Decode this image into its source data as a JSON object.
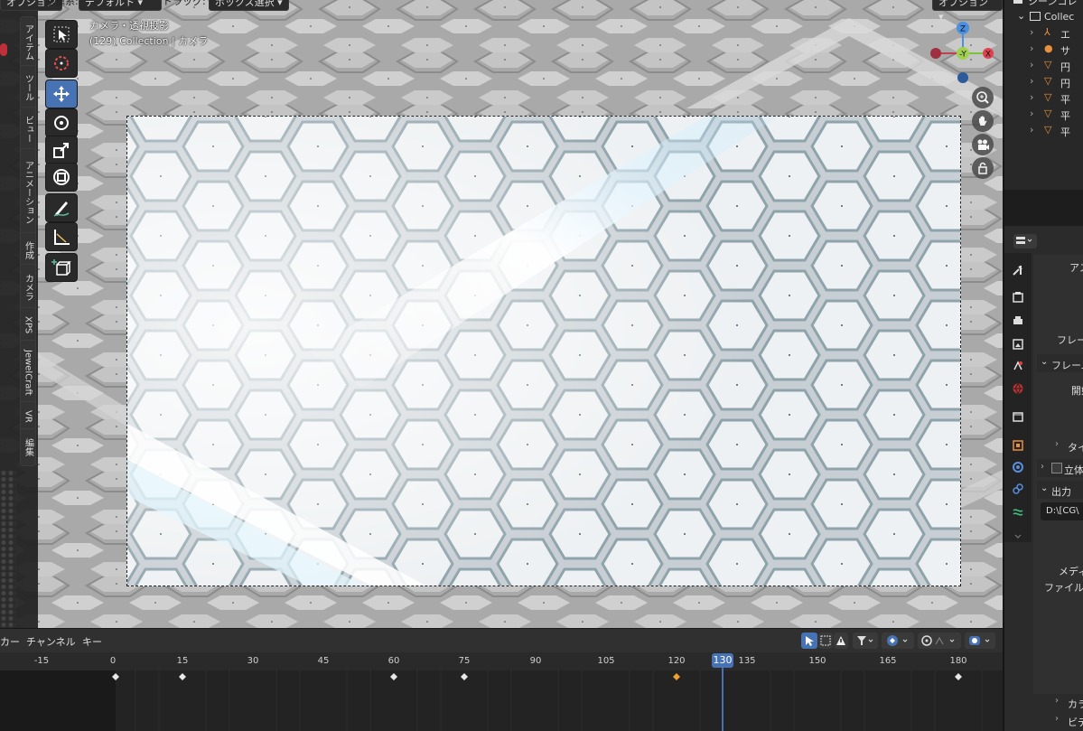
{
  "header": {
    "options_left": "オプション",
    "orientation_label": "座標系:",
    "orientation_value": "デフォルト",
    "drag_label": "ドラッグ:",
    "drag_value": "ボックス選択",
    "options_right": "オプション"
  },
  "viewport": {
    "view_name": "カメラ・透視投影",
    "view_info": "(129) Collection | カメラ"
  },
  "sidebar_tabs": [
    "アイテム",
    "ツール",
    "ビュー",
    "アニメーション",
    "作成",
    "カメラ",
    "XPS",
    "JewelCraft",
    "VR",
    "編集"
  ],
  "tools": [
    "select-box-icon",
    "cursor-icon",
    "move-icon",
    "rotate-icon",
    "scale-icon",
    "transform-icon",
    "annotate-icon",
    "measure-icon",
    "add-cube-icon"
  ],
  "gizmo": {
    "z": "Z",
    "y": "Y",
    "x": "X",
    "neg_y": "-Y"
  },
  "timeline": {
    "menus": [
      "カー",
      "チャンネル",
      "キー"
    ],
    "ticks": [
      "-15",
      "0",
      "15",
      "30",
      "45",
      "60",
      "75",
      "90",
      "105",
      "120",
      "135",
      "150",
      "165",
      "180"
    ],
    "current_frame": "130"
  },
  "outliner": {
    "header": "シーンコレ",
    "collection": "Collec",
    "items": [
      "エ",
      "サ",
      "円",
      "円",
      "平",
      "平",
      "平"
    ]
  },
  "properties": {
    "aspect": "アス",
    "frame_rate": "フレー",
    "frame_range_panel": "フレーム",
    "start": "開始",
    "time_stretch": "タイム",
    "stereoscopy": "立体",
    "output_panel": "出力",
    "output_path": "D:\\[CG\\",
    "media_type": "メディ",
    "file_format": "ファイルフ",
    "color": "カラー",
    "video": "ビデ"
  },
  "colors": {
    "accent": "#4772b3",
    "playhead": "#4772b3",
    "keyframe_selected": "#f0a030"
  }
}
